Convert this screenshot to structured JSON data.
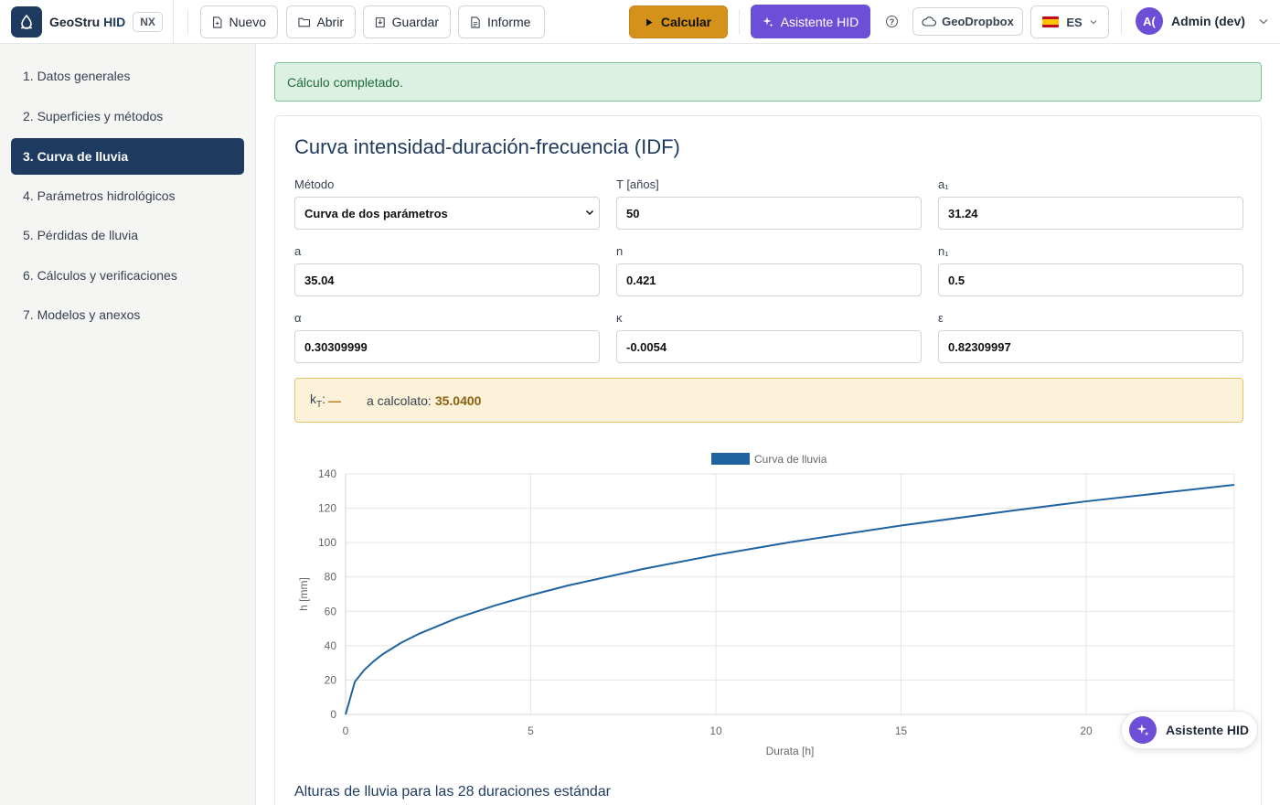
{
  "header": {
    "brand_prefix": "GeoStru",
    "brand_highlight": "HID",
    "edition_badge": "NX",
    "toolbar": {
      "new_label": "Nuevo",
      "open_label": "Abrir",
      "save_label": "Guardar",
      "report_label": "Informe",
      "calc_label": "Calcular",
      "assistant_label": "Asistente HID"
    },
    "help_glyph": "?",
    "cloud_label": "GeoDropbox",
    "language": "ES",
    "user_initials": "A(",
    "user_name": "Admin (dev)"
  },
  "sidebar": {
    "items": [
      {
        "label": "1. Datos generales",
        "active": false
      },
      {
        "label": "2. Superficies y métodos",
        "active": false
      },
      {
        "label": "3. Curva de lluvia",
        "active": true
      },
      {
        "label": "4. Parámetros hidrológicos",
        "active": false
      },
      {
        "label": "5. Pérdidas de lluvia",
        "active": false
      },
      {
        "label": "6. Cálculos y verificaciones",
        "active": false
      },
      {
        "label": "7. Modelos y anexos",
        "active": false
      }
    ]
  },
  "alert": {
    "message": "Cálculo completado."
  },
  "card": {
    "title": "Curva intensidad-duración-frecuencia (IDF)",
    "fields": {
      "method": {
        "label": "Método",
        "value": "Curva de dos parámetros"
      },
      "T": {
        "label": "T [años]",
        "value": "50"
      },
      "a1": {
        "label": "a₁",
        "value": "31.24"
      },
      "a": {
        "label": "a",
        "value": "35.04"
      },
      "n": {
        "label": "n",
        "value": "0.421"
      },
      "n1": {
        "label": "n₁",
        "value": "0.5"
      },
      "alpha": {
        "label": "α",
        "value": "0.30309999"
      },
      "kappa": {
        "label": "κ",
        "value": "-0.0054"
      },
      "epsilon": {
        "label": "ε",
        "value": "0.82309997"
      }
    },
    "info": {
      "kt_label_main": "k",
      "kt_label_sub": "T",
      "kt_value": "—",
      "calc_label": "a calcolato:",
      "calc_value": "35.0400"
    },
    "table_title": "Alturas de lluvia para las 28 duraciones estándar"
  },
  "chart_data": {
    "type": "line",
    "legend": "Curva de lluvia",
    "xlabel": "Durata [h]",
    "ylabel": "h [mm]",
    "xlim": [
      0,
      24
    ],
    "ylim": [
      0,
      140
    ],
    "x_ticks": [
      0,
      5,
      10,
      15,
      20
    ],
    "y_ticks": [
      0,
      20,
      40,
      60,
      80,
      100,
      120,
      140
    ],
    "grid": true,
    "legend_position": "top-center",
    "color": "#1f64a0",
    "series": [
      {
        "name": "Curva de lluvia",
        "x": [
          0,
          0.25,
          0.5,
          0.75,
          1,
          1.5,
          2,
          3,
          4,
          5,
          6,
          8,
          10,
          12,
          15,
          18,
          20,
          24
        ],
        "y": [
          0,
          19.0,
          25.8,
          30.8,
          35.0,
          41.7,
          47.1,
          56.0,
          63.2,
          69.4,
          75.0,
          84.5,
          92.8,
          100.2,
          109.9,
          118.6,
          124.0,
          133.6
        ]
      }
    ]
  },
  "fab": {
    "label": "Asistente HID"
  }
}
